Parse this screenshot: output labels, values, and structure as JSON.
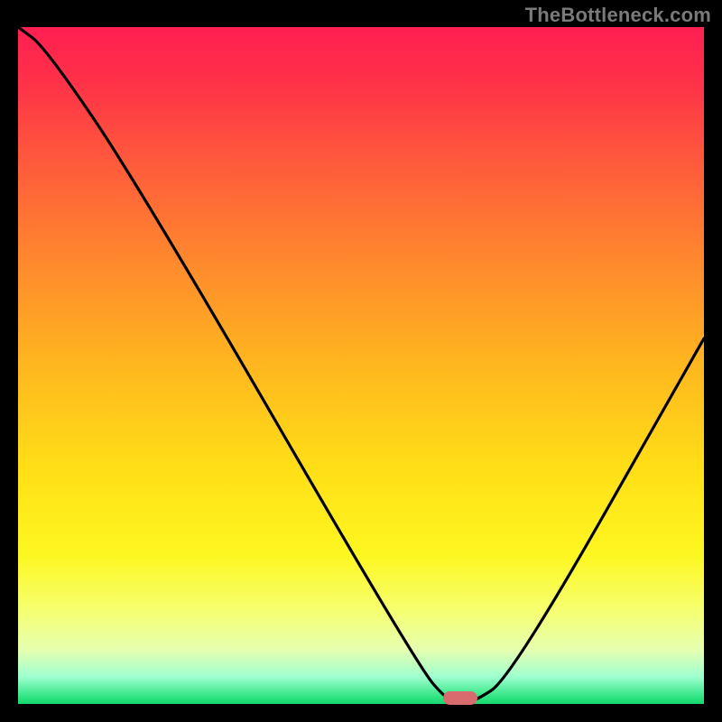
{
  "watermark": "TheBottleneck.com",
  "chart_data": {
    "type": "line",
    "title": "",
    "xlabel": "",
    "ylabel": "",
    "xlim": [
      0,
      100
    ],
    "ylim": [
      0,
      100
    ],
    "x": [
      0,
      4,
      18,
      58,
      63,
      66,
      72,
      100
    ],
    "values": [
      100,
      97,
      76,
      6,
      0,
      0,
      4,
      54
    ],
    "optimal_range_pct": [
      62,
      67
    ],
    "description": "V-shaped bottleneck curve over a vertical red-to-green gradient; minimum (0 %) around x ≈ 63–67 %, right branch rises back to ~54 % at x = 100 %."
  },
  "colors": {
    "background": "#000000",
    "curve": "#000000",
    "marker": "#d96a6e",
    "gradient_top": "#ff1f52",
    "gradient_bottom": "#17d66f"
  }
}
